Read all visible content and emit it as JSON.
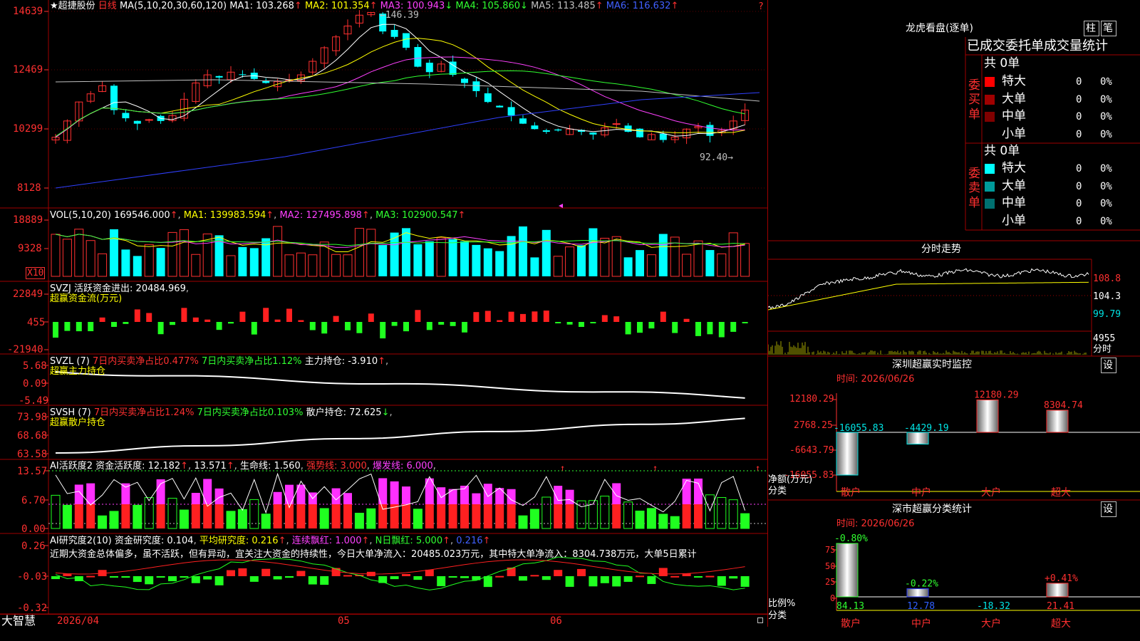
{
  "title_bar": {
    "stock_name": "★超捷股份",
    "period": "日线",
    "ma_label": "MA(5,10,20,30,60,120)",
    "ma1": "MA1: 103.268",
    "ma2": "MA2: 101.354",
    "ma3": "MA3: 100.943",
    "ma4": "MA4: 105.860",
    "ma5": "MA5: 113.485",
    "ma6": "MA6: 116.632",
    "up": "↑",
    "down": "↓",
    "help": "?"
  },
  "kline": {
    "y_ticks": [
      "14639",
      "12469",
      "10299",
      "8128"
    ],
    "high_label": "146.39",
    "low_label": "92.40"
  },
  "vol": {
    "label": "VOL(5,10,20)",
    "v": "169546.000",
    "ma1": "MA1: 139983.594",
    "ma2": "MA2: 127495.898",
    "ma3": "MA3: 102900.547",
    "up": "↑",
    "y_ticks": [
      "18889",
      "9328"
    ],
    "unit": "X10"
  },
  "svzj": {
    "label": "SVZJ",
    "text": "活跃资金进出: 20484.969",
    "sub": "超赢资金流(万元)",
    "y_ticks": [
      "22849",
      "455",
      "-21940"
    ]
  },
  "svzl": {
    "label": "SVZL (7)",
    "t1": "7日内买卖净占比0.477%",
    "t2": "7日内买卖净占比1.12%",
    "t3": "主力持仓: -3.910",
    "sub": "超赢主力持仓",
    "y_ticks": [
      "5.68",
      "0.09",
      "-5.49"
    ]
  },
  "svsh": {
    "label": "SVSH (7)",
    "t1": "7日内买卖净占比1.24%",
    "t2": "7日内买卖净占比0.103%",
    "t3": "散户持仓: 72.625",
    "sub": "超赢散户持仓",
    "y_ticks": [
      "73.98",
      "68.68",
      "63.58"
    ]
  },
  "ai1": {
    "label": "AI活跃度2",
    "t1": "资金活跃度: 12.182",
    "t2": "13.571",
    "t3": "生命线: 1.560",
    "t4": "强势线: 3.000",
    "t5": "爆发线: 6.000",
    "y_ticks": [
      "13.57",
      "6.70",
      "0.00"
    ]
  },
  "ai2": {
    "label": "AI研究度2(10)",
    "t1": "资金研究度: 0.104",
    "t2": "平均研究度: 0.216",
    "t3": "连续飘红: 1.000",
    "t4": "N日飘红: 5.000",
    "t5": "0.216",
    "comment": "近期大资金总体偏多，虽不活跃，但有异动，宜关注大资金的持续性，今日大单净流入：20485.023万元，其中特大单净流入：8304.738万元，大单5日累计",
    "y_ticks": [
      "0.26",
      "-0.03",
      "-0.32"
    ]
  },
  "bottom": {
    "brand": "大智慧",
    "d1": "2026/04",
    "d2": "05",
    "d3": "06"
  },
  "lhb": {
    "title": "龙虎看盘(逐单)",
    "btn1": "柱",
    "btn2": "笔",
    "tabs": "已成交委托单成交量统计",
    "buy_label": "委买单",
    "sell_label": "委卖单",
    "total": "共 0单",
    "buy_rows": [
      {
        "name": "特大",
        "v": "0",
        "p": "0%",
        "c": "#ff0000"
      },
      {
        "name": "大单",
        "v": "0",
        "p": "0%",
        "c": "#a00000"
      },
      {
        "name": "中单",
        "v": "0",
        "p": "0%",
        "c": "#800000"
      },
      {
        "name": "小单",
        "v": "0",
        "p": "0%",
        "c": "#000000"
      }
    ],
    "sell_rows": [
      {
        "name": "特大",
        "v": "0",
        "p": "0%",
        "c": "#00ffff"
      },
      {
        "name": "大单",
        "v": "0",
        "p": "0%",
        "c": "#009a9a"
      },
      {
        "name": "中单",
        "v": "0",
        "p": "0%",
        "c": "#007070"
      },
      {
        "name": "小单",
        "v": "0",
        "p": "0%",
        "c": "#000000"
      }
    ]
  },
  "intraday": {
    "title": "分时走势",
    "p1": "108.8",
    "p2": "104.3",
    "p3": "99.79",
    "vol": "4955",
    "unit": "分时"
  },
  "sz_monitor": {
    "title": "深圳超赢实时监控",
    "btn": "设",
    "time": "时间: 2026/06/26",
    "y_ticks": [
      "12180.29",
      "2768.25",
      "-6643.79",
      "-16055.83"
    ],
    "ylabel": "净额(万元)",
    "xlabel": "分类",
    "cats": [
      "散户",
      "中户",
      "大户",
      "超大"
    ],
    "values": [
      -16055.83,
      -4429.19,
      12180.29,
      8304.74
    ],
    "labels": [
      "-16055.83",
      "-4429.19",
      "12180.29",
      "8304.74"
    ]
  },
  "sz_stats": {
    "title": "深市超赢分类统计",
    "btn": "设",
    "time": "时间: 2026/06/26",
    "y_ticks": [
      "75",
      "50",
      "25",
      "0"
    ],
    "ylabel": "比例%",
    "xlabel": "分类",
    "cats": [
      "散户",
      "中户",
      "大户",
      "超大"
    ],
    "values": [
      84.13,
      12.78,
      -18.32,
      21.41
    ],
    "labels": [
      "84.13",
      "12.78",
      "-18.32",
      "21.41"
    ],
    "top_labels": [
      "-0.80%",
      "-0.22%",
      "",
      "+0.41%"
    ]
  }
}
